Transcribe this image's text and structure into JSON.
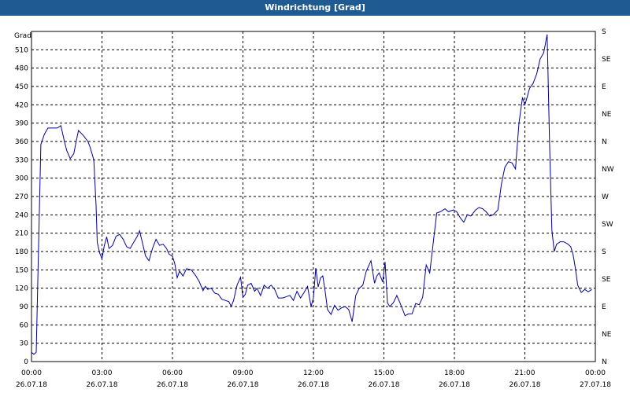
{
  "window": {
    "title": "Windrichtung [Grad]"
  },
  "colors": {
    "title_bar": "#1f5a93",
    "line": "#0000a0",
    "grid": "#000000",
    "background": "#ffffff"
  },
  "chart_data": {
    "type": "line",
    "title": "Windrichtung [Grad]",
    "ylabel": "Grad",
    "xlabel": "",
    "ylim": [
      0,
      540
    ],
    "yticks": [
      0,
      30,
      60,
      90,
      120,
      150,
      180,
      210,
      240,
      270,
      300,
      330,
      360,
      390,
      420,
      450,
      480,
      510
    ],
    "right_axis_labels": [
      "N",
      "NE",
      "E",
      "SE",
      "S",
      "SW",
      "W",
      "NW",
      "N",
      "NE",
      "E",
      "SE",
      "S"
    ],
    "xlim": [
      "26.07.18 00:00",
      "27.07.18 00:00"
    ],
    "x_ticks": [
      {
        "time": "00:00",
        "date": "26.07.18"
      },
      {
        "time": "03:00",
        "date": "26.07.18"
      },
      {
        "time": "06:00",
        "date": "26.07.18"
      },
      {
        "time": "09:00",
        "date": "26.07.18"
      },
      {
        "time": "12:00",
        "date": "26.07.18"
      },
      {
        "time": "15:00",
        "date": "26.07.18"
      },
      {
        "time": "18:00",
        "date": "26.07.18"
      },
      {
        "time": "21:00",
        "date": "26.07.18"
      },
      {
        "time": "00:00",
        "date": "27.07.18"
      }
    ],
    "grid": true,
    "series": [
      {
        "x_unit": "hours",
        "points": [
          [
            0.0,
            15
          ],
          [
            0.1,
            12
          ],
          [
            0.2,
            15
          ],
          [
            0.3,
            190
          ],
          [
            0.4,
            355
          ],
          [
            0.55,
            372
          ],
          [
            0.7,
            382
          ],
          [
            0.9,
            382
          ],
          [
            1.1,
            382
          ],
          [
            1.25,
            386
          ],
          [
            1.4,
            360
          ],
          [
            1.5,
            345
          ],
          [
            1.65,
            332
          ],
          [
            1.8,
            340
          ],
          [
            1.9,
            360
          ],
          [
            2.0,
            378
          ],
          [
            2.2,
            370
          ],
          [
            2.4,
            360
          ],
          [
            2.5,
            350
          ],
          [
            2.65,
            330
          ],
          [
            2.75,
            255
          ],
          [
            2.8,
            195
          ],
          [
            2.9,
            178
          ],
          [
            3.0,
            168
          ],
          [
            3.1,
            190
          ],
          [
            3.2,
            204
          ],
          [
            3.3,
            185
          ],
          [
            3.45,
            190
          ],
          [
            3.6,
            205
          ],
          [
            3.75,
            208
          ],
          [
            3.9,
            200
          ],
          [
            4.05,
            188
          ],
          [
            4.2,
            185
          ],
          [
            4.35,
            195
          ],
          [
            4.5,
            205
          ],
          [
            4.6,
            214
          ],
          [
            4.75,
            190
          ],
          [
            4.85,
            173
          ],
          [
            5.0,
            165
          ],
          [
            5.15,
            185
          ],
          [
            5.3,
            200
          ],
          [
            5.45,
            190
          ],
          [
            5.6,
            192
          ],
          [
            5.75,
            185
          ],
          [
            5.85,
            176
          ],
          [
            6.0,
            172
          ],
          [
            6.1,
            160
          ],
          [
            6.2,
            137
          ],
          [
            6.3,
            148
          ],
          [
            6.45,
            140
          ],
          [
            6.6,
            152
          ],
          [
            6.8,
            150
          ],
          [
            7.0,
            140
          ],
          [
            7.15,
            130
          ],
          [
            7.3,
            116
          ],
          [
            7.4,
            123
          ],
          [
            7.5,
            118
          ],
          [
            7.65,
            120
          ],
          [
            7.8,
            112
          ],
          [
            7.95,
            110
          ],
          [
            8.1,
            102
          ],
          [
            8.25,
            100
          ],
          [
            8.4,
            98
          ],
          [
            8.5,
            90
          ],
          [
            8.6,
            100
          ],
          [
            8.75,
            125
          ],
          [
            8.9,
            138
          ],
          [
            9.0,
            105
          ],
          [
            9.1,
            110
          ],
          [
            9.2,
            125
          ],
          [
            9.35,
            128
          ],
          [
            9.5,
            115
          ],
          [
            9.6,
            120
          ],
          [
            9.75,
            108
          ],
          [
            9.9,
            125
          ],
          [
            10.05,
            120
          ],
          [
            10.2,
            125
          ],
          [
            10.35,
            118
          ],
          [
            10.5,
            104
          ],
          [
            10.7,
            104
          ],
          [
            10.9,
            107
          ],
          [
            11.0,
            108
          ],
          [
            11.15,
            100
          ],
          [
            11.3,
            115
          ],
          [
            11.45,
            104
          ],
          [
            11.6,
            113
          ],
          [
            11.75,
            123
          ],
          [
            11.9,
            90
          ],
          [
            12.0,
            104
          ],
          [
            12.1,
            153
          ],
          [
            12.2,
            122
          ],
          [
            12.3,
            137
          ],
          [
            12.4,
            140
          ],
          [
            12.5,
            115
          ],
          [
            12.6,
            85
          ],
          [
            12.75,
            77
          ],
          [
            12.9,
            92
          ],
          [
            13.05,
            84
          ],
          [
            13.2,
            88
          ],
          [
            13.35,
            90
          ],
          [
            13.5,
            85
          ],
          [
            13.65,
            65
          ],
          [
            13.8,
            108
          ],
          [
            13.95,
            120
          ],
          [
            14.1,
            125
          ],
          [
            14.25,
            148
          ],
          [
            14.45,
            165
          ],
          [
            14.6,
            128
          ],
          [
            14.7,
            140
          ],
          [
            14.8,
            145
          ],
          [
            14.95,
            130
          ],
          [
            15.05,
            163
          ],
          [
            15.15,
            96
          ],
          [
            15.25,
            90
          ],
          [
            15.4,
            96
          ],
          [
            15.55,
            108
          ],
          [
            15.75,
            90
          ],
          [
            15.9,
            75
          ],
          [
            16.05,
            78
          ],
          [
            16.2,
            78
          ],
          [
            16.35,
            95
          ],
          [
            16.5,
            93
          ],
          [
            16.65,
            105
          ],
          [
            16.8,
            158
          ],
          [
            16.95,
            145
          ],
          [
            17.1,
            195
          ],
          [
            17.25,
            243
          ],
          [
            17.4,
            245
          ],
          [
            17.6,
            250
          ],
          [
            17.75,
            245
          ],
          [
            17.95,
            248
          ],
          [
            18.1,
            245
          ],
          [
            18.25,
            235
          ],
          [
            18.4,
            228
          ],
          [
            18.55,
            240
          ],
          [
            18.7,
            238
          ],
          [
            18.9,
            248
          ],
          [
            19.05,
            252
          ],
          [
            19.2,
            250
          ],
          [
            19.35,
            245
          ],
          [
            19.5,
            238
          ],
          [
            19.65,
            240
          ],
          [
            19.85,
            248
          ],
          [
            20.0,
            290
          ],
          [
            20.15,
            318
          ],
          [
            20.3,
            327
          ],
          [
            20.45,
            325
          ],
          [
            20.6,
            315
          ],
          [
            20.75,
            390
          ],
          [
            20.9,
            432
          ],
          [
            21.0,
            420
          ],
          [
            21.1,
            433
          ],
          [
            21.2,
            447
          ],
          [
            21.35,
            455
          ],
          [
            21.5,
            470
          ],
          [
            21.65,
            495
          ],
          [
            21.8,
            505
          ],
          [
            21.95,
            535
          ],
          [
            22.05,
            360
          ],
          [
            22.15,
            215
          ],
          [
            22.25,
            180
          ],
          [
            22.35,
            192
          ],
          [
            22.5,
            196
          ],
          [
            22.65,
            196
          ],
          [
            22.8,
            193
          ],
          [
            22.95,
            188
          ],
          [
            23.05,
            175
          ],
          [
            23.15,
            153
          ],
          [
            23.25,
            125
          ],
          [
            23.4,
            113
          ],
          [
            23.55,
            118
          ],
          [
            23.7,
            114
          ],
          [
            23.85,
            118
          ]
        ]
      }
    ]
  }
}
